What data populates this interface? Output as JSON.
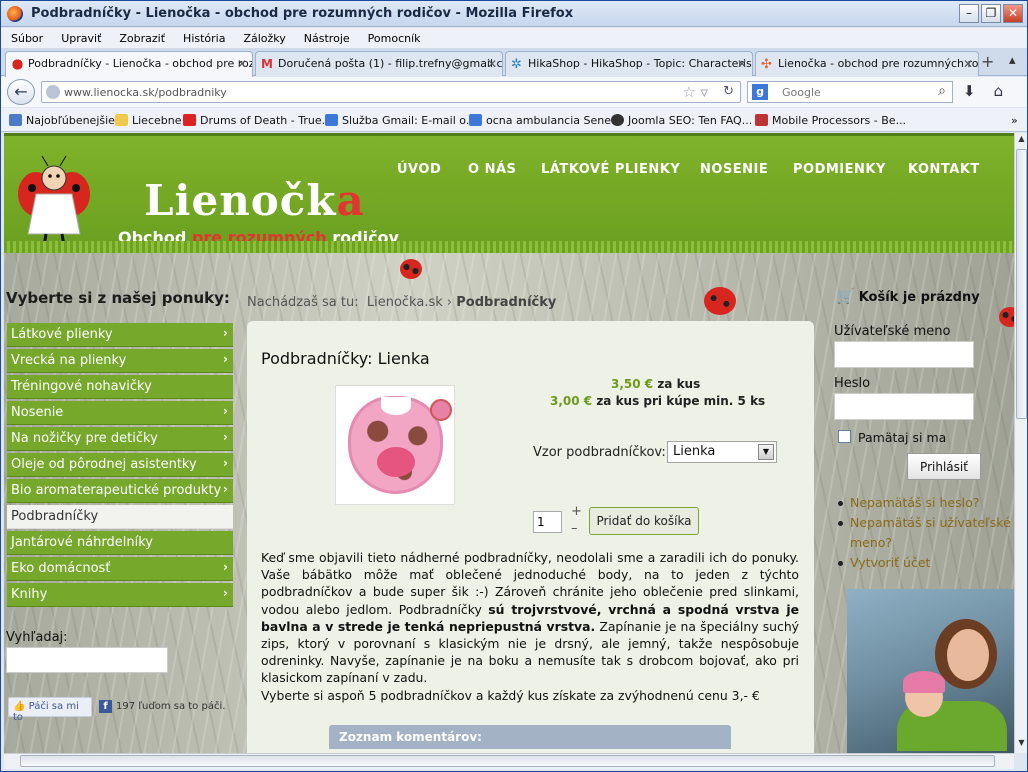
{
  "window": {
    "title": "Podbradníčky - Lienočka - obchod pre rozumných rodičov - Mozilla Firefox"
  },
  "menubar": [
    "Súbor",
    "Upraviť",
    "Zobraziť",
    "História",
    "Záložky",
    "Nástroje",
    "Pomocník"
  ],
  "tabs": [
    {
      "label": "Podbradníčky - Lienočka - obchod pre roz..."
    },
    {
      "label": "Doručená pošta (1) - filip.trefny@gmail.c..."
    },
    {
      "label": "HikaShop - HikaShop - Topic: Characteris..."
    },
    {
      "label": "Lienočka - obchod pre rozumných rodičo..."
    }
  ],
  "nav": {
    "url_host": "www.lienocka.sk/",
    "url_path": "podbradniky",
    "search_placeholder": "Google"
  },
  "bookmarks": [
    "Najobľúbenejšie",
    "Liecebne",
    "Drums of Death - True...",
    "Služba Gmail: E-mail o...",
    "ocna ambulancia Sene...",
    "Joomla SEO: Ten FAQ...",
    "Mobile Processors - Be..."
  ],
  "site": {
    "logo_main": "Lienočk",
    "logo_a": "a",
    "logo_sub_1": "Obchod ",
    "logo_sub_2": "pre rozumných",
    "logo_sub_3": " rodičov",
    "topnav": [
      "ÚVOD",
      "O NÁS",
      "LÁTKOVÉ PLIENKY",
      "NOSENIE",
      "PODMIENKY",
      "KONTAKT"
    ]
  },
  "left": {
    "heading": "Vyberte si z našej ponuky:",
    "menu": [
      {
        "label": "Látkové plienky",
        "chev": "›"
      },
      {
        "label": "Vrecká na plienky",
        "chev": "›"
      },
      {
        "label": "Tréningové nohavičky",
        "chev": ""
      },
      {
        "label": "Nosenie",
        "chev": "›"
      },
      {
        "label": "Na nožičky pre detičky",
        "chev": "›"
      },
      {
        "label": "Oleje od pôrodnej asistentky",
        "chev": "›"
      },
      {
        "label": "Bio aromaterapeutické produkty",
        "chev": "›"
      },
      {
        "label": "Podbradníčky",
        "chev": ""
      },
      {
        "label": "Jantárové náhrdelníky",
        "chev": ""
      },
      {
        "label": "Eko domácnosť",
        "chev": "›"
      },
      {
        "label": "Knihy",
        "chev": "›"
      }
    ],
    "search_label": "Vyhľadaj:",
    "fb_like": "Páči sa mi to",
    "fb_count": "197 ľuďom sa to páči."
  },
  "breadcrumb": {
    "prefix": "Nachádzaš sa tu:",
    "home": "Lienočka.sk",
    "sep": "›",
    "current": "Podbradníčky"
  },
  "product": {
    "title": "Podbradníčky: Lienka",
    "price1": "3,50 €",
    "price1_suffix": " za kus",
    "price2": "3,00 €",
    "price2_suffix": " za kus pri kúpe min. 5 ks",
    "variant_label": "Vzor podbradníčkov:",
    "variant_value": "Lienka",
    "qty": "1",
    "plus": "+",
    "minus": "–",
    "add_to_cart": "Pridať do košíka",
    "desc_1": "Keď sme objavili tieto nádherné podbradníčky, neodolali sme a zaradili ich do ponuky. Vaše bábätko môže mať oblečené jednoduché body, na to jeden z týchto podbradníčkov a bude super šik :-) Zároveň chránite jeho oblečenie pred slinkami, vodou alebo jedlom. Podbradníčky ",
    "desc_bold": "sú trojvrstvové, vrchná a spodná vrstva je bavlna a v strede je tenká nepriepustná vrstva.",
    "desc_2": " Zapínanie je na špeciálny suchý zips, ktorý v porovnaní s klasickým nie je drsný, ale jemný, takže nespôsobuje odreninky. Navyše, zapínanie je na boku a nemusíte tak s drobcom bojovať, ako pri klasickom zapínaní v zadu.",
    "desc_3": "Vyberte si aspoň 5 podbradníčkov a každý kus získate za zvýhodnenú cenu 3,- €",
    "comments_label": "Zoznam komentárov:"
  },
  "right": {
    "cart": "Košík je prázdny",
    "username_label": "Užívateľské meno",
    "password_label": "Heslo",
    "remember": "Pamätaj si ma",
    "login": "Prihlásiť",
    "links": [
      "Nepamätáš si heslo?",
      "Nepamätáš si užívateľské meno?",
      "Vytvoriť účet"
    ]
  },
  "colors": {
    "green": "#76a92b",
    "price_green": "#6e9a1c",
    "link": "#8a6a1a",
    "ladybug": "#d7261e"
  }
}
